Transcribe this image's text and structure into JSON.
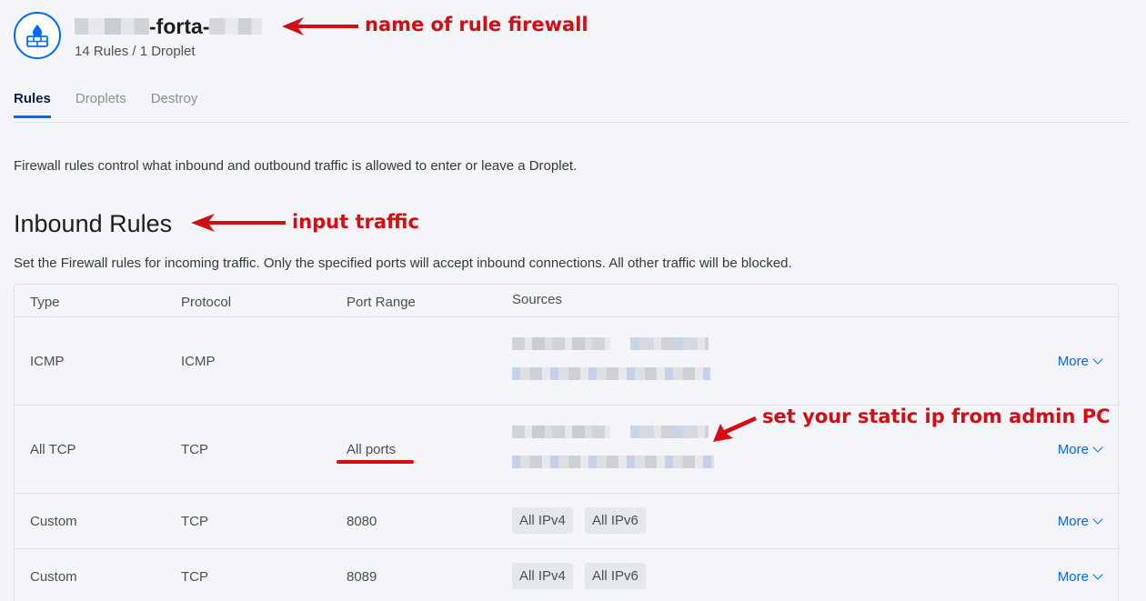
{
  "header": {
    "name_middle": "-forta-",
    "subtitle": "14 Rules / 1 Droplet"
  },
  "annotations": {
    "name": "name of rule firewall",
    "inbound": "input traffic",
    "static_ip": "set your static ip from admin PC"
  },
  "tabs": [
    {
      "label": "Rules",
      "active": true
    },
    {
      "label": "Droplets",
      "active": false
    },
    {
      "label": "Destroy",
      "active": false
    }
  ],
  "intro": "Firewall rules control what inbound and outbound traffic is allowed to enter or leave a Droplet.",
  "inbound": {
    "title": "Inbound Rules",
    "description": "Set the Firewall rules for incoming traffic. Only the specified ports will accept inbound connections. All other traffic will be blocked.",
    "columns": [
      "Type",
      "Protocol",
      "Port Range",
      "Sources"
    ],
    "rows": [
      {
        "type": "ICMP",
        "protocol": "ICMP",
        "port": "",
        "sources": [],
        "more": "More"
      },
      {
        "type": "All TCP",
        "protocol": "TCP",
        "port": "All ports",
        "sources": [],
        "more": "More"
      },
      {
        "type": "Custom",
        "protocol": "TCP",
        "port": "8080",
        "sources": [
          "All IPv4",
          "All IPv6"
        ],
        "more": "More"
      },
      {
        "type": "Custom",
        "protocol": "TCP",
        "port": "8089",
        "sources": [
          "All IPv4",
          "All IPv6"
        ],
        "more": "More"
      }
    ]
  },
  "colors": {
    "accent": "#0069ff",
    "annotation": "#d40d12"
  },
  "icons": {
    "firewall": "firewall-icon",
    "chevron": "chevron-down-icon"
  }
}
